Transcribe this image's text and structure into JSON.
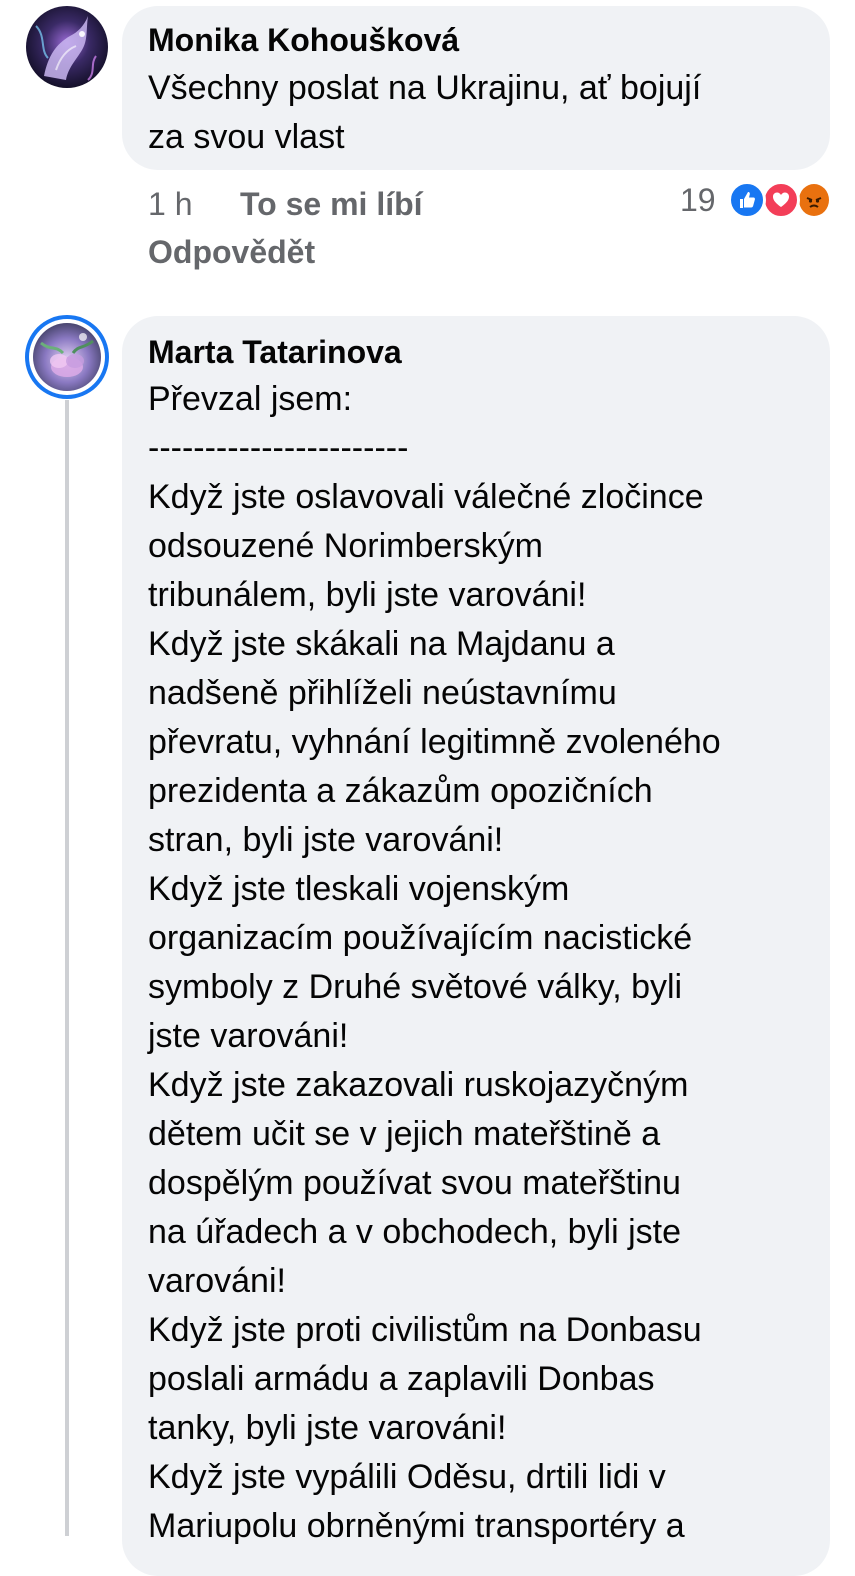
{
  "comments": [
    {
      "author": "Monika Kohoušková",
      "text": "Všechny poslat na Ukrajinu, ať bojují\nza svou vlast",
      "time": "1 h",
      "like_label": "To se mi líbí",
      "reply_label": "Odpovědět",
      "reaction_count": "19",
      "reactions": [
        "like-icon",
        "love-icon",
        "angry-icon"
      ]
    },
    {
      "author": "Marta Tatarinova",
      "text": "Převzal jsem:\n-----------------------\nKdyž jste oslavovali válečné zločince\nodsouzené Norimberským\ntribunálem, byli jste varováni!\nKdyž jste skákali na Majdanu a\nnadšeně přihlíželi neústavnímu\npřevratu, vyhnání legitimně zvoleného\nprezidenta a zákazům opozičních\nstran, byli jste varováni!\nKdyž jste tleskali vojenským\norganizacím používajícím nacistické\nsymboly z Druhé světové války, byli\njste varováni!\nKdyž jste zakazovali ruskojazyčným\ndětem učit se v jejich mateřštině a\ndospělým používat svou mateřštinu\nna úřadech a v obchodech, byli jste\nvarováni!\nKdyž jste proti civilistům na Donbasu\nposlali armádu a zaplavili Donbas\ntanky, byli jste varováni!\nKdyž jste vypálili Oděsu, drtili lidi v\nMariupolu obrněnými transportéry a"
    }
  ],
  "colors": {
    "bubble": "#f0f2f5",
    "meta_text": "#65676b",
    "like_blue": "#1877f2",
    "love_red": "#f33e58",
    "angry_orange": "#e9710f",
    "story_ring": "#1877f2"
  }
}
